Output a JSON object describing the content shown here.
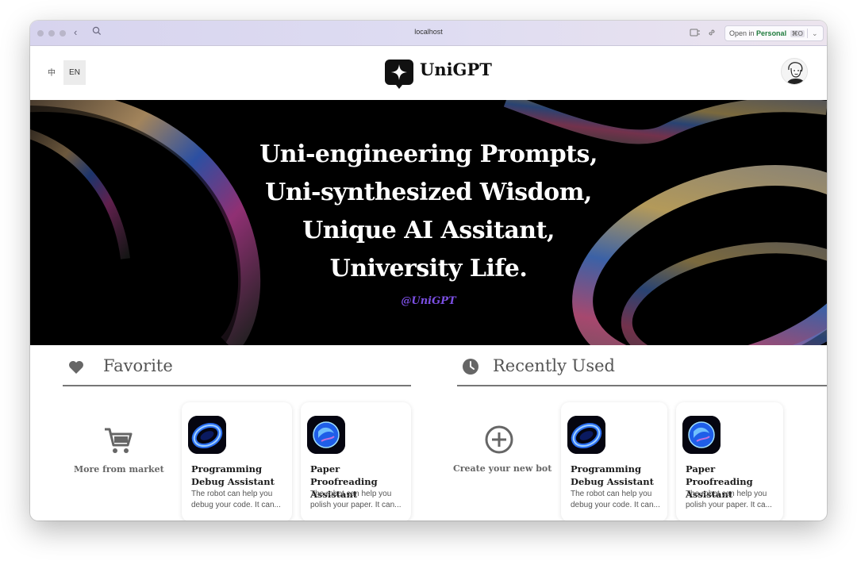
{
  "browser": {
    "url": "localhost",
    "open_in_prefix": "Open in",
    "open_in_brand": "Personal",
    "open_in_shortcut": "⌘O",
    "back_icon": "chevron-left-icon",
    "search_icon": "search-icon",
    "brand_color": "#1e7b3c"
  },
  "header": {
    "lang_zh": "中",
    "lang_en": "EN",
    "app_name": "UniGPT",
    "logo_icon": "sparkle-chat-icon",
    "avatar_icon": "user-avatar"
  },
  "hero": {
    "lines": [
      "Uni-engineering Prompts,",
      "Uni-synthesized Wisdom,",
      "Unique AI Assitant,",
      "University Life."
    ],
    "tag": "@UniGPT",
    "tag_color": "#7b4fe3"
  },
  "favorite": {
    "title": "Favorite",
    "icon": "heart-icon",
    "market_label": "More from market",
    "market_icon": "cart-icon",
    "bots": [
      {
        "title": "Programming Debug Assistant",
        "desc": "The robot can help you debug your code. It can..."
      },
      {
        "title": "Paper Proofreading Assistant",
        "desc": "The robot can help you polish your paper. It can..."
      }
    ]
  },
  "recent": {
    "title": "Recently Used",
    "icon": "clock-icon",
    "create_label": "Create your new bot",
    "create_icon": "plus-circle-icon",
    "bots": [
      {
        "title": "Programming Debug Assistant",
        "desc": "The robot can help you debug your code. It can..."
      },
      {
        "title": "Paper Proofreading Assistant",
        "desc": "The robot can help you polish your paper. It ca..."
      }
    ]
  }
}
